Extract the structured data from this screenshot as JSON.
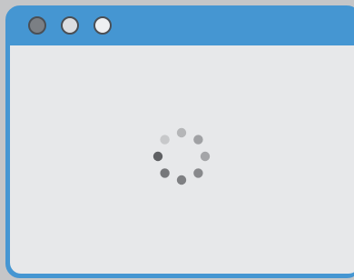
{
  "window": {
    "titlebar_color": "#4596d2",
    "content_bg": "#e7e8ea",
    "buttons": [
      {
        "name": "close",
        "color": "#7b7f84"
      },
      {
        "name": "minimize",
        "color": "#dcdee1"
      },
      {
        "name": "maximize",
        "color": "#eef0f2"
      }
    ]
  },
  "spinner": {
    "state": "loading",
    "dot_count": 8,
    "dot_colors": [
      "#bcbdbf",
      "#adaeb0",
      "#9fa0a3",
      "#909194",
      "#828386",
      "#737477",
      "#646568",
      "#d0d1d3"
    ]
  }
}
